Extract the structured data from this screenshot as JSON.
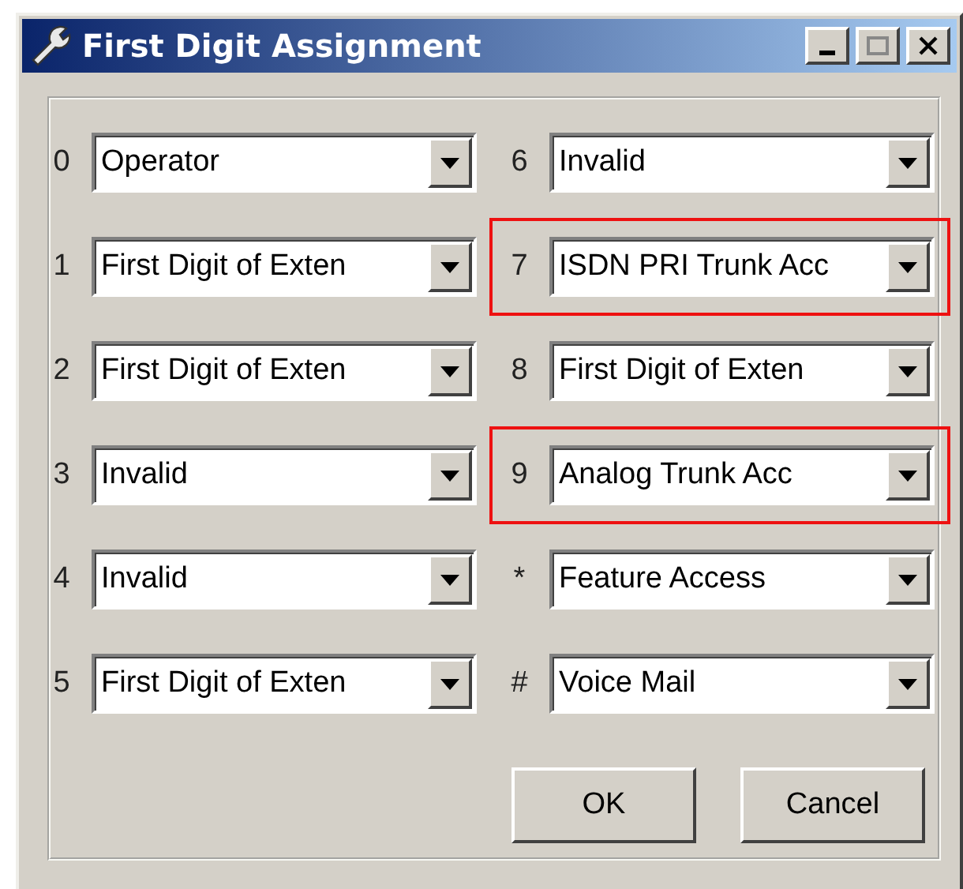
{
  "window": {
    "title": "First Digit Assignment"
  },
  "columns": [
    [
      {
        "digit": "0",
        "value": "Operator",
        "highlighted": false
      },
      {
        "digit": "1",
        "value": "First Digit of Exten",
        "highlighted": false
      },
      {
        "digit": "2",
        "value": "First Digit of Exten",
        "highlighted": false
      },
      {
        "digit": "3",
        "value": "Invalid",
        "highlighted": false
      },
      {
        "digit": "4",
        "value": "Invalid",
        "highlighted": false
      },
      {
        "digit": "5",
        "value": "First Digit of Exten",
        "highlighted": false
      }
    ],
    [
      {
        "digit": "6",
        "value": "Invalid",
        "highlighted": false
      },
      {
        "digit": "7",
        "value": "ISDN PRI Trunk Acc",
        "highlighted": true
      },
      {
        "digit": "8",
        "value": "First Digit of Exten",
        "highlighted": false
      },
      {
        "digit": "9",
        "value": "Analog Trunk Acc",
        "highlighted": true
      },
      {
        "digit": "*",
        "value": "Feature Access",
        "highlighted": false
      },
      {
        "digit": "#",
        "value": "Voice Mail",
        "highlighted": false
      }
    ]
  ],
  "buttons": [
    "OK",
    "Cancel"
  ]
}
